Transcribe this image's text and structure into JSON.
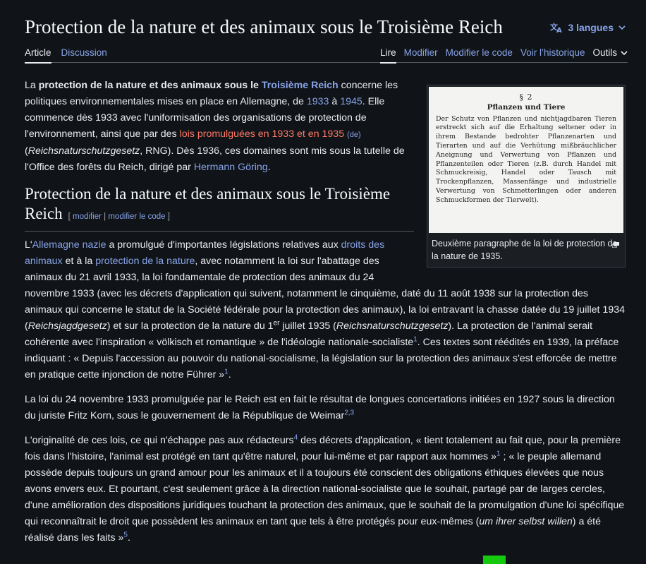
{
  "title": "Protection de la nature et des animaux sous le Troisième Reich",
  "languages": {
    "label": "3 langues",
    "icon": "translate-icon"
  },
  "tabs": {
    "article": "Article",
    "discussion": "Discussion"
  },
  "actions": {
    "read": "Lire",
    "edit": "Modifier",
    "edit_code": "Modifier le code",
    "history": "Voir l’historique",
    "tools": "Outils"
  },
  "intro": {
    "t1": "La ",
    "b1": "protection de la nature et des animaux sous le ",
    "l1": "Troisième Reich",
    "t2": " concerne les politiques environnementales mises en place en Allemagne, de ",
    "l2": "1933",
    "t3": " à ",
    "l3": "1945",
    "t4": ". Elle commence dès 1933 avec l'uniformisation des organisations de protection de l'environnement, ainsi que par des ",
    "r1": "lois promulguées en 1933 et en 1935",
    "de": "(de)",
    "t5": " (",
    "i1": "Reichsnaturschutzgesetz",
    "t6": ", RNG). Dès 1936, ces domaines sont mis sous la tutelle de l'Office des forêts du Reich, dirigé par ",
    "l4": "Hermann Göring",
    "t7": "."
  },
  "infobox": {
    "section": "§ 2",
    "heading": "Pflanzen und Tiere",
    "body": "Der Schutz von Pflanzen und nichtjagdbaren Tieren erstreckt sich auf die Erhaltung seltener oder in ihrem Bestande bedrohter Pflanzenarten und Tierarten und auf die Verhütung mißbräuchlicher Aneignung und Verwertung von Pflanzen und Pflanzenteilen oder Tieren (z.B. durch Handel mit Schmuckreisig, Handel oder Tausch mit Trockenpflanzen, Massenfänge und industrielle Verwertung von Schmetterlingen oder anderen Schmuckformen der Tierwelt).",
    "caption": "Deuxième paragraphe de la loi de protection de la nature de 1935."
  },
  "section": {
    "heading": "Protection de la nature et des animaux sous le Troisième Reich",
    "open": "[ ",
    "edit": "modifier",
    "sep": " | ",
    "edit_code": "modifier le code",
    "close": " ]"
  },
  "p1": {
    "t1": "L'",
    "l1": "Allemagne nazie",
    "t2": " a promulgué d'importantes législations relatives aux ",
    "l2": "droits des animaux",
    "t3": " et à la ",
    "l3": "protection de la nature",
    "t4": ", avec notamment la loi sur l'abattage des animaux du 21 avril 1933, la loi fondamentale de protection des animaux du 24 novembre 1933 (avec les décrets d'application qui suivent, notamment le cinquième, daté du 11 août 1938 sur la protection des animaux qui concerne le statut de la Société fédérale pour la protection des animaux), la loi entravant la chasse datée du 19 juillet 1934 (",
    "i1": "Reichsjagdgesetz",
    "t5": ") et sur la protection de la nature du 1",
    "sup": "er",
    "t6": " juillet 1935 (",
    "i2": "Reichsnaturschutzgesetz",
    "t7": "). La protection de l'animal serait cohérente avec l'inspiration « völkisch et romantique » de l'idéologie nationale-socialiste",
    "r1": "1",
    "t8": ". Ces textes sont réédités en 1939, la préface indiquant : « Depuis l'accession au pouvoir du national-socialisme, la législation sur la protection des animaux s'est efforcée de mettre en pratique cette injonction de notre Führer »",
    "r2": "1",
    "t9": "."
  },
  "p2": {
    "t1": "La loi du 24 novembre 1933 promulguée par le Reich est en fait le résultat de longues concertations initiées en 1927 sous la direction du juriste Fritz Korn, sous le gouvernement de la République de Weimar",
    "r1": "2,3"
  },
  "p3": {
    "t1": "L'originalité de ces lois, ce qui n'échappe pas aux rédacteurs",
    "r1": "4",
    "t2": " des décrets d'application, « tient totalement au fait que, pour la première fois dans l'histoire, l'animal est protégé en tant qu'être naturel, pour lui-même et par rapport aux hommes »",
    "r2": "1",
    "t3": " ; « le peuple allemand possède depuis toujours un grand amour pour les animaux et il a toujours été conscient des obligations éthiques élevées que nous avons envers eux. Et pourtant, c'est seulement grâce à la direction national-socialiste que le souhait, partagé par de larges cercles, d'une amélioration des dispositions juridiques touchant la protection des animaux, que le souhait de la promulgation d'une loi spécifique qui reconnaîtrait le droit que possèdent les animaux en tant que tels à être protégés pour eux-mêmes (",
    "i1": "um ihrer selbst willen",
    "t4": ") a été réalisé dans les faits »",
    "r3": "5",
    "t5": "."
  }
}
